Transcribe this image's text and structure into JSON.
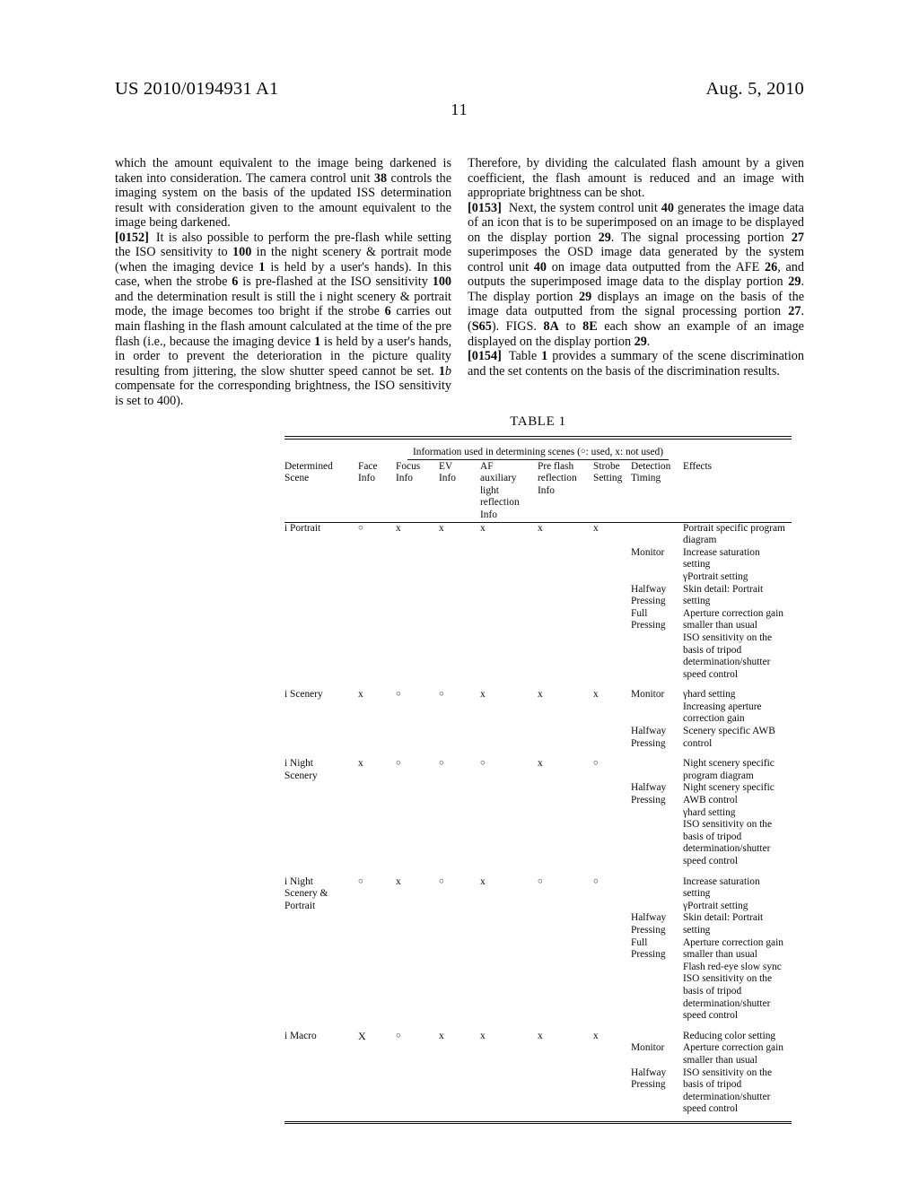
{
  "header": {
    "publication_number": "US 2010/0194931 A1",
    "publication_date": "Aug. 5, 2010",
    "page_number": "11"
  },
  "columns": {
    "left": [
      {
        "id": "cont-0151",
        "number": "",
        "text": "which the amount equivalent to the image being darkened is taken into consideration. The camera control unit 38 controls the imaging system on the basis of the updated ISS determination result with consideration given to the amount equivalent to the image being darkened."
      },
      {
        "id": "para-0152",
        "number": "[0152]",
        "text": "It is also possible to perform the pre-flash while setting the ISO sensitivity to 100 in the night scenery & portrait mode (when the imaging device 1 is held by a user's hands). In this case, when the strobe 6 is pre-flashed at the ISO sensitivity 100 and the determination result is still the i night scenery & portrait mode, the image becomes too bright if the strobe 6 carries out main flashing in the flash amount calculated at the time of the pre flash (i.e., because the imaging device 1 is held by a user's hands, in order to prevent the deterioration in the picture quality resulting from jittering, the slow shutter speed cannot be set. 1b compensate for the corresponding brightness, the ISO sensitivity is set to 400)."
      }
    ],
    "right": [
      {
        "id": "cont-0152",
        "number": "",
        "text": "Therefore, by dividing the calculated flash amount by a given coefficient, the flash amount is reduced and an image with appropriate brightness can be shot."
      },
      {
        "id": "para-0153",
        "number": "[0153]",
        "text": "Next, the system control unit 40 generates the image data of an icon that is to be superimposed on an image to be displayed on the display portion 29. The signal processing portion 27 superimposes the OSD image data generated by the system control unit 40 on image data outputted from the AFE 26, and outputs the superimposed image data to the display portion 29. The display portion 29 displays an image on the basis of the image data outputted from the signal processing portion 27. (S65). FIGS. 8A to 8E each show an example of an image displayed on the display portion 29."
      },
      {
        "id": "para-0154",
        "number": "[0154]",
        "text": "Table 1 provides a summary of the scene discrimination and the set contents on the basis of the discrimination results."
      }
    ]
  },
  "table": {
    "caption": "TABLE 1",
    "spanner": "Information used in determining scenes (○: used, x: not used)",
    "headers": {
      "scene": [
        "Determined",
        "Scene"
      ],
      "face": [
        "Face",
        "Info"
      ],
      "focus": [
        "Focus",
        "Info"
      ],
      "ev": [
        "EV",
        "Info"
      ],
      "af": [
        "AF",
        "auxiliary",
        "light",
        "reflection",
        "Info"
      ],
      "pre_flash": [
        "Pre flash",
        "reflection",
        "Info"
      ],
      "strobe": [
        "Strobe",
        "Setting"
      ],
      "detection": [
        "Detection",
        "Timing"
      ],
      "effects": [
        "Effects"
      ]
    },
    "rows": [
      {
        "scene": [
          "i Portrait"
        ],
        "symbols": [
          "○",
          "x",
          "x",
          "x",
          "x",
          "x"
        ],
        "blocks": [
          {
            "timing": [],
            "effect": [
              "Portrait specific program",
              "diagram"
            ]
          },
          {
            "timing": [
              "Monitor"
            ],
            "effect": [
              "Increase saturation",
              "setting",
              "γPortrait setting"
            ]
          },
          {
            "timing": [
              "Halfway",
              "Pressing"
            ],
            "effect": [
              "Skin detail: Portrait",
              "setting"
            ]
          },
          {
            "timing": [
              "Full",
              "Pressing"
            ],
            "effect": [
              "Aperture correction gain",
              "smaller than usual",
              "ISO sensitivity on the",
              "basis of tripod",
              "determination/shutter",
              "speed control"
            ]
          }
        ]
      },
      {
        "scene": [
          "i Scenery"
        ],
        "symbols": [
          "x",
          "○",
          "○",
          "x",
          "x",
          "x"
        ],
        "blocks": [
          {
            "timing": [
              "Monitor"
            ],
            "effect": [
              "γhard setting",
              "Increasing aperture",
              "correction gain"
            ]
          },
          {
            "timing": [
              "Halfway",
              "Pressing"
            ],
            "effect": [
              "Scenery specific AWB",
              "control"
            ]
          }
        ]
      },
      {
        "scene": [
          "i Night",
          "Scenery"
        ],
        "symbols": [
          "x",
          "○",
          "○",
          "○",
          "x",
          "○"
        ],
        "blocks": [
          {
            "timing": [],
            "effect": [
              "Night scenery specific",
              "program diagram"
            ]
          },
          {
            "timing": [
              "Halfway",
              "Pressing"
            ],
            "effect": [
              "Night scenery specific",
              "AWB control",
              "γhard setting",
              "ISO sensitivity on the",
              "basis of tripod",
              "determination/shutter",
              "speed control"
            ]
          }
        ]
      },
      {
        "scene": [
          "i Night",
          "Scenery &",
          "Portrait"
        ],
        "symbols": [
          "○",
          "x",
          "○",
          "x",
          "○",
          "○"
        ],
        "blocks": [
          {
            "timing": [],
            "effect": [
              "Increase saturation",
              "setting",
              "γPortrait setting"
            ]
          },
          {
            "timing": [
              "Halfway",
              "Pressing"
            ],
            "effect": [
              "Skin detail: Portrait",
              "setting"
            ]
          },
          {
            "timing": [
              "Full",
              "Pressing"
            ],
            "effect": [
              "Aperture correction gain",
              "smaller than usual",
              "Flash red-eye slow sync",
              "ISO sensitivity on the",
              "basis of tripod",
              "determination/shutter",
              "speed control"
            ]
          }
        ]
      },
      {
        "scene": [
          "i Macro"
        ],
        "symbols": [
          "X",
          "○",
          "x",
          "x",
          "x",
          "x"
        ],
        "blocks": [
          {
            "timing": [],
            "effect": [
              "Reducing color setting"
            ]
          },
          {
            "timing": [
              "Monitor"
            ],
            "effect": [
              "Aperture correction gain",
              "smaller than usual"
            ]
          },
          {
            "timing": [
              "Halfway",
              "Pressing"
            ],
            "effect": [
              "ISO sensitivity on the",
              "basis of tripod",
              "determination/shutter",
              "speed control"
            ]
          }
        ]
      }
    ]
  }
}
